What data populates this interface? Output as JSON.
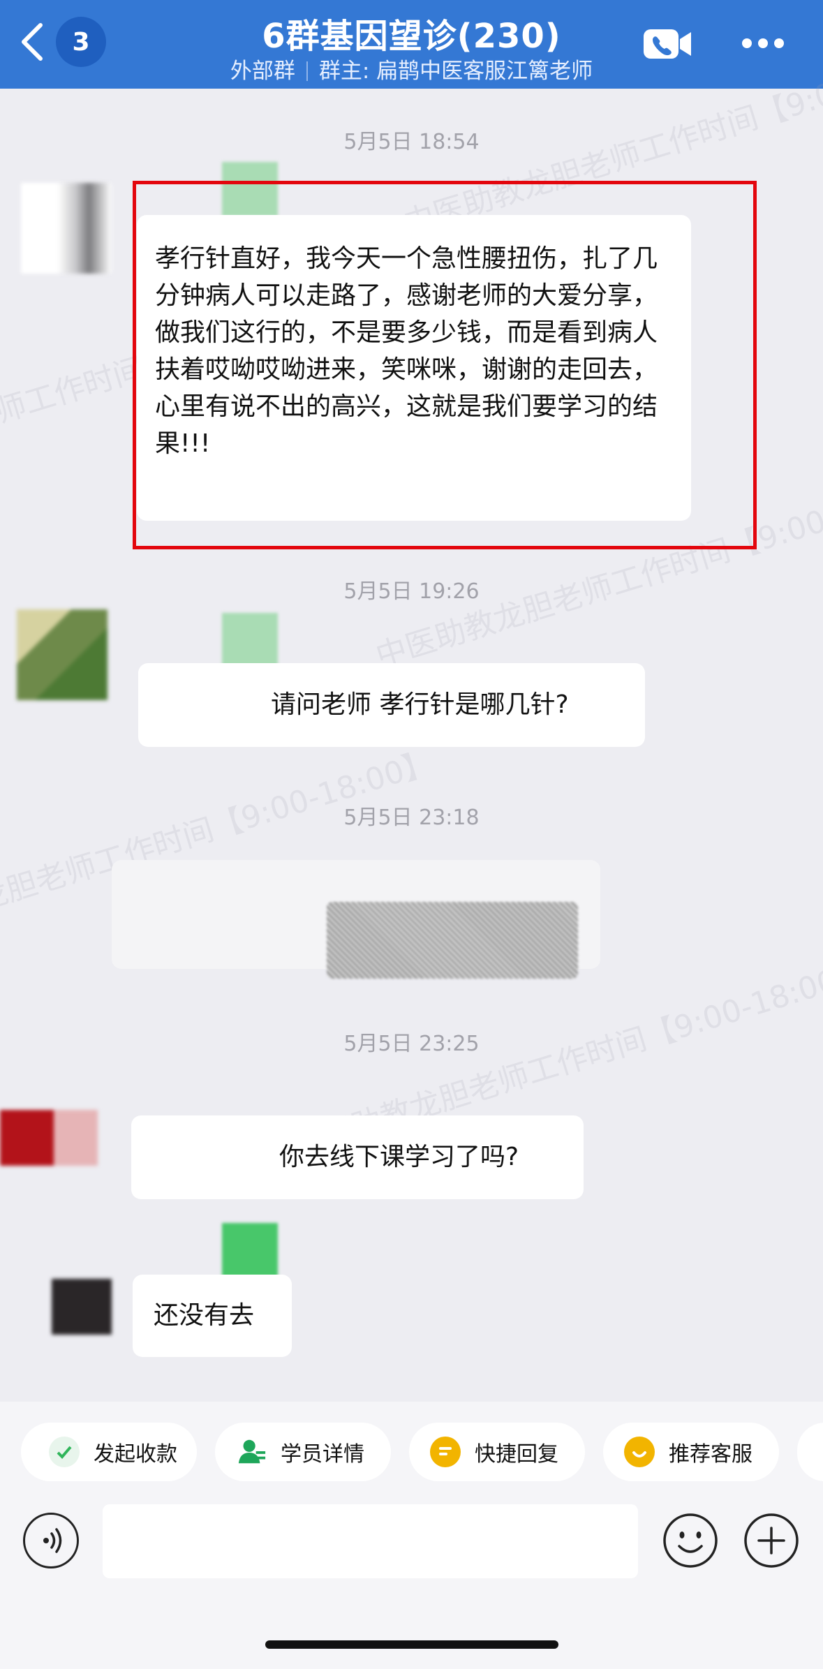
{
  "header": {
    "back_count": "3",
    "title": "6群基因望诊(230)",
    "group_type": "外部群",
    "owner": "群主: 扁鹊中医客服江篱老师"
  },
  "watermark": "中医助教龙胆老师工作时间【9:00-18:00】",
  "messages": [
    {
      "time": "5月5日 18:54",
      "text": "孝行针直好，我今天一个急性腰扭伤，扎了几分钟病人可以走路了，感谢老师的大爱分享，做我们这行的，不是要多少钱，而是看到病人扶着哎呦哎呦进来，笑咪咪，谢谢的走回去，心里有说不出的高兴，这就是我们要学习的结果!!!"
    },
    {
      "time": "5月5日 19:26",
      "text": "请问老师 孝行针是哪几针?"
    },
    {
      "time": "5月5日 23:18",
      "text": ""
    },
    {
      "time": "5月5日 23:25",
      "text": "你去线下课学习了吗?"
    },
    {
      "time": "",
      "text": "还没有去"
    }
  ],
  "quick_actions": [
    {
      "label": "发起收款",
      "icon": "payment-icon",
      "color": "#2fb55a"
    },
    {
      "label": "学员详情",
      "icon": "student-icon",
      "color": "#1ea65a"
    },
    {
      "label": "快捷回复",
      "icon": "quick-reply-icon",
      "color": "#f2b400"
    },
    {
      "label": "推荐客服",
      "icon": "recommend-service-icon",
      "color": "#f2b400"
    }
  ],
  "colors": {
    "header": "#3478d4",
    "highlight": "#e3060d"
  }
}
